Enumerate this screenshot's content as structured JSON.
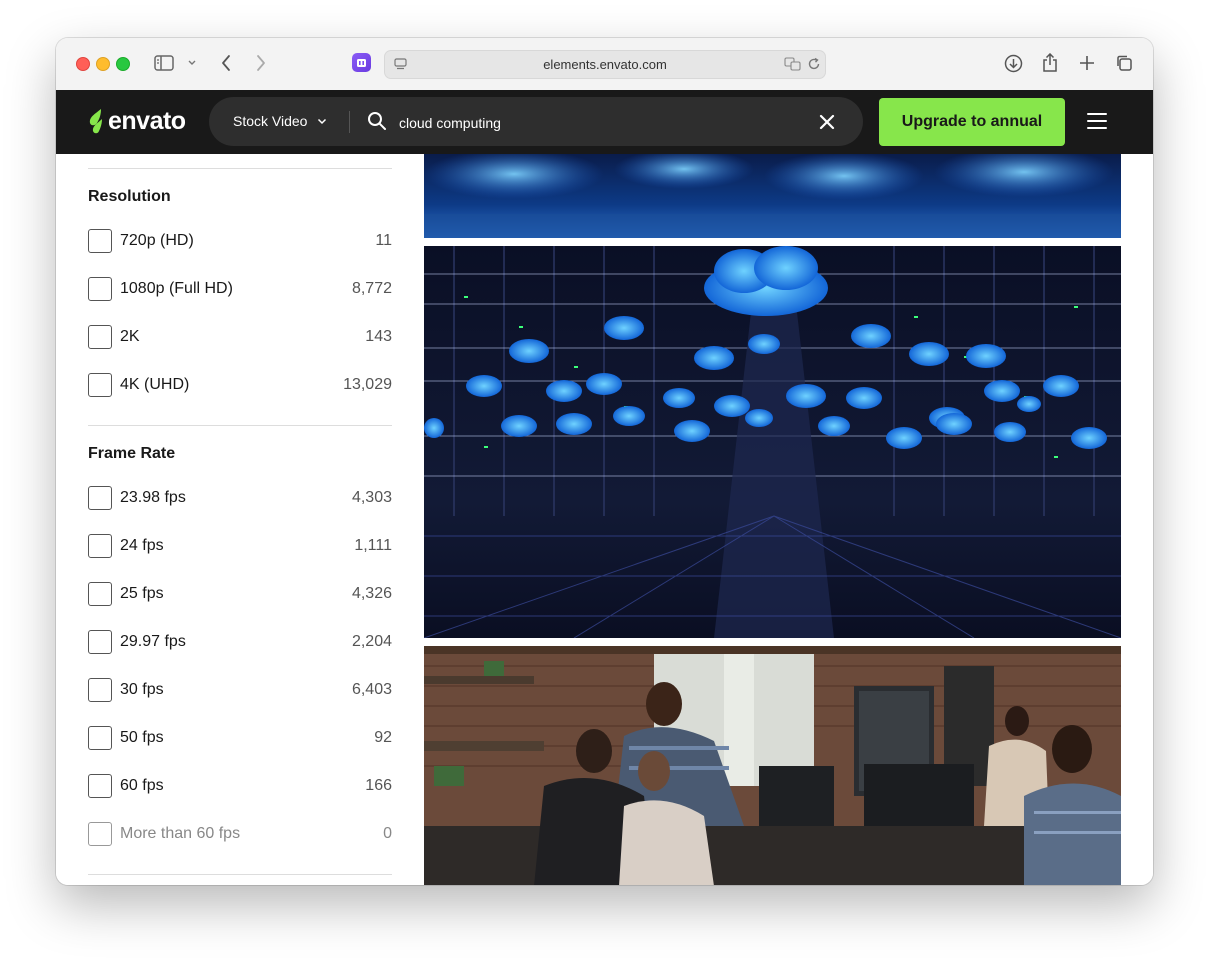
{
  "browser": {
    "url": "elements.envato.com"
  },
  "header": {
    "logo_text": "envato",
    "category": "Stock Video",
    "search_value": "cloud computing",
    "upgrade_label": "Upgrade to annual"
  },
  "sidebar": {
    "resolution": {
      "title": "Resolution",
      "items": [
        {
          "label": "720p (HD)",
          "count": "11"
        },
        {
          "label": "1080p (Full HD)",
          "count": "8,772"
        },
        {
          "label": "2K",
          "count": "143"
        },
        {
          "label": "4K (UHD)",
          "count": "13,029"
        }
      ]
    },
    "frame_rate": {
      "title": "Frame Rate",
      "items": [
        {
          "label": "23.98 fps",
          "count": "4,303"
        },
        {
          "label": "24 fps",
          "count": "1,111"
        },
        {
          "label": "25 fps",
          "count": "4,326"
        },
        {
          "label": "29.97 fps",
          "count": "2,204"
        },
        {
          "label": "30 fps",
          "count": "6,403"
        },
        {
          "label": "50 fps",
          "count": "92"
        },
        {
          "label": "60 fps",
          "count": "166"
        },
        {
          "label": "More than 60 fps",
          "count": "0"
        }
      ]
    }
  },
  "colors": {
    "header_bg": "#191919",
    "accent_green": "#87e64b"
  }
}
